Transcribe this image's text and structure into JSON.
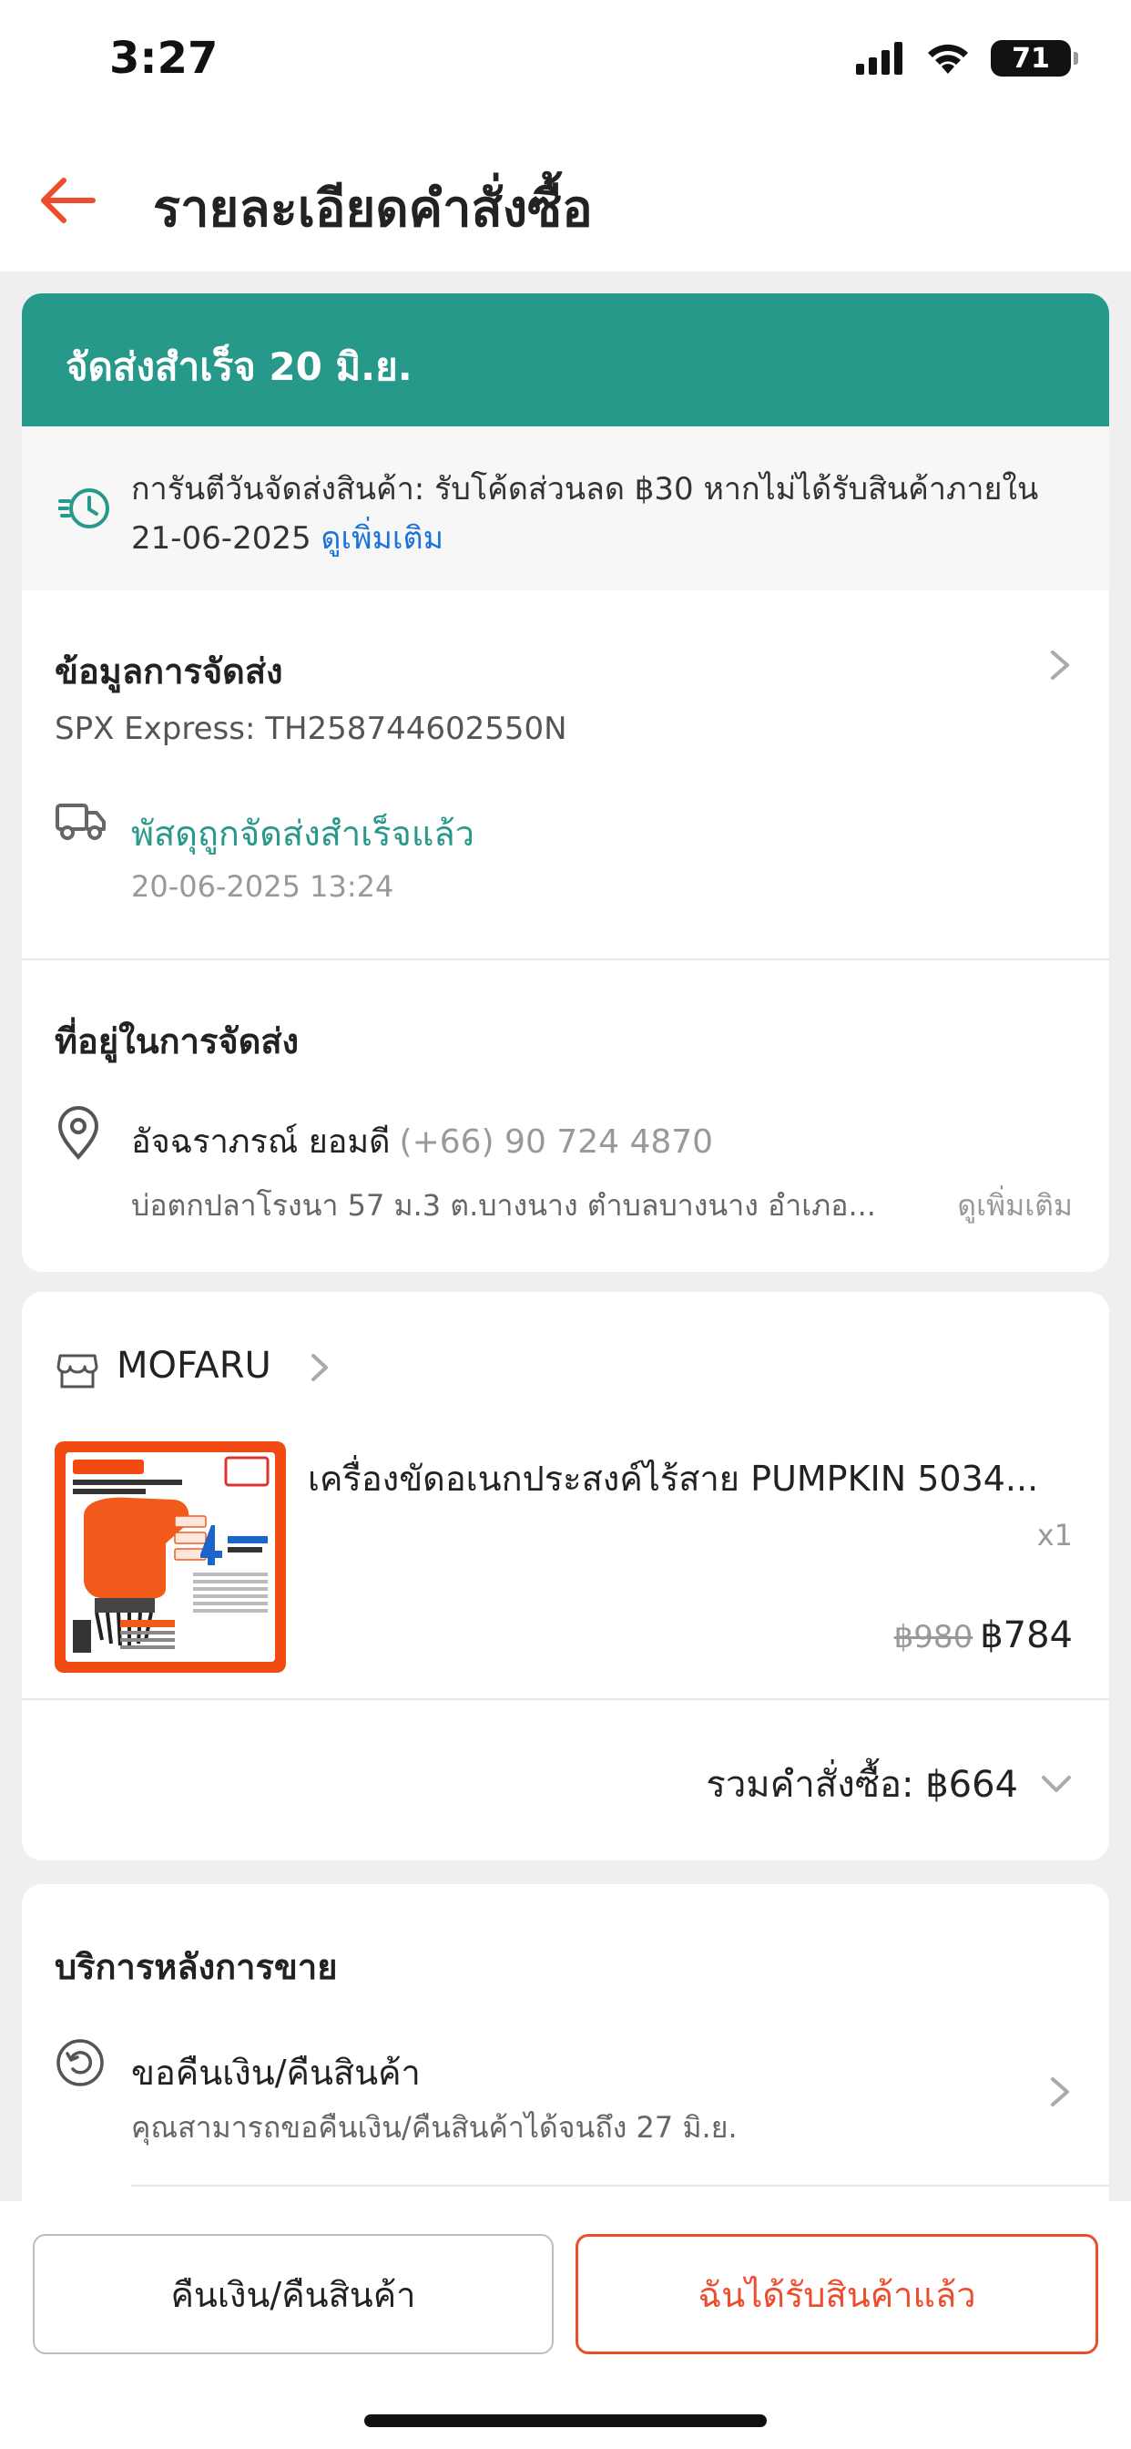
{
  "status_bar": {
    "time": "3:27",
    "battery": "71"
  },
  "header": {
    "title": "รายละเอียดคำสั่งซื้อ"
  },
  "delivery_banner": {
    "text": "จัดส่งสำเร็จ 20 มิ.ย."
  },
  "guarantee": {
    "text": "การันตีวันจัดส่งสินค้า: รับโค้ดส่วนลด ฿30 หากไม่ได้รับสินค้าภายใน 21-06-2025",
    "link": "ดูเพิ่มเติม"
  },
  "shipping_info": {
    "heading": "ข้อมูลการจัดส่ง",
    "tracking": "SPX Express: TH258744602550N",
    "status": "พัสดุถูกจัดส่งสำเร็จแล้ว",
    "timestamp": "20-06-2025 13:24"
  },
  "address": {
    "heading": "ที่อยู่ในการจัดส่ง",
    "name": "อัจฉราภรณ์ ยอมดี",
    "phone": "(+66) 90 724 4870",
    "line": "บ่อตกปลาโรงนา 57 ม.3 ต.บางนาง ตำบลบางนาง อำเภอ...",
    "more": "ดูเพิ่มเติม"
  },
  "shop": {
    "name": "MOFARU"
  },
  "product": {
    "name": "เครื่องขัดอเนกประสงค์ไร้สาย PUMPKIN 5034...",
    "qty": "x1",
    "original_price": "฿980",
    "price": "฿784"
  },
  "order_total": {
    "label": "รวมคำสั่งซื้อ: ฿664"
  },
  "after_sales": {
    "heading": "บริการหลังการขาย",
    "return_title": "ขอคืนเงิน/คืนสินค้า",
    "return_sub": "คุณสามารถขอคืนเงิน/คืนสินค้าได้จนถึง 27 มิ.ย."
  },
  "actions": {
    "refund": "คืนเงิน/คืนสินค้า",
    "received": "ฉันได้รับสินค้าแล้ว"
  },
  "colors": {
    "accent": "#ee4d2d",
    "teal": "#26998a",
    "link": "#1a73d8"
  },
  "icons": [
    "back-arrow-icon",
    "clock-icon",
    "chevron-right-icon",
    "truck-icon",
    "location-pin-icon",
    "shop-icon",
    "chevron-down-icon",
    "return-icon",
    "signal-icon",
    "wifi-icon",
    "battery-icon"
  ]
}
